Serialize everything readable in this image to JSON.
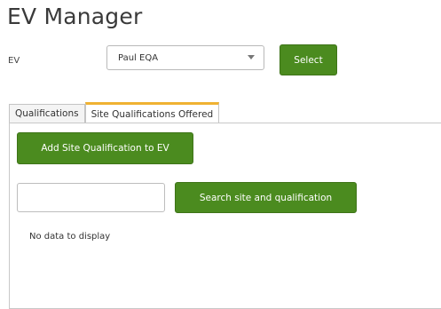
{
  "header": {
    "title": "EV Manager"
  },
  "ev": {
    "label": "EV",
    "selected": "Paul EQA",
    "select_label": "Select"
  },
  "tabs": [
    {
      "label": "Qualifications",
      "active": false
    },
    {
      "label": "Site Qualifications Offered",
      "active": true
    }
  ],
  "panel": {
    "add_button": "Add Site Qualification to EV",
    "search": {
      "value": "",
      "placeholder": ""
    },
    "search_button": "Search site and qualification",
    "empty_text": "No data to display"
  },
  "colors": {
    "button_green": "#4b8b1f",
    "active_tab_accent": "#f0b232"
  }
}
